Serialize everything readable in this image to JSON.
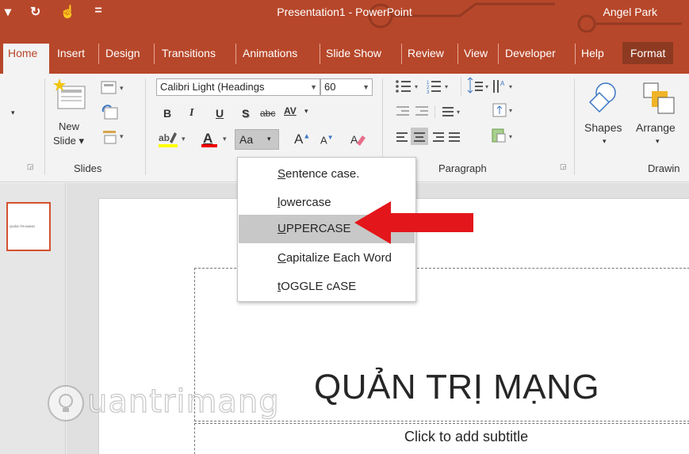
{
  "title_bar": {
    "qat_undo": "▾",
    "qat_redo": "↻",
    "qat_touch": "☝",
    "qat_customize": "=",
    "app_title": "Presentation1  -  PowerPoint",
    "user_name": "Angel Park"
  },
  "tabs": [
    {
      "label": "Home",
      "active": true
    },
    {
      "label": "Insert"
    },
    {
      "label": "Design"
    },
    {
      "label": "Transitions"
    },
    {
      "label": "Animations"
    },
    {
      "label": "Slide Show"
    },
    {
      "label": "Review"
    },
    {
      "label": "View"
    },
    {
      "label": "Developer"
    },
    {
      "label": "Help"
    },
    {
      "label": "Format"
    }
  ],
  "ribbon": {
    "slides_group": {
      "new_slide_line1": "New",
      "new_slide_line2": "Slide ▾",
      "label": "Slides"
    },
    "font_group": {
      "font_name": "Calibri Light (Headings",
      "font_size": "60",
      "bold": "B",
      "italic": "I",
      "underline": "U",
      "shadow": "S",
      "strike": "abc",
      "spacing": "AV",
      "change_case": "Aa",
      "grow": "A",
      "shrink": "A"
    },
    "paragraph_group": {
      "label": "Paragraph"
    },
    "drawing_group": {
      "shapes": "Shapes",
      "arrange": "Arrange",
      "label": "Drawin"
    }
  },
  "change_case_menu": {
    "items": [
      {
        "label": "Sentence case.",
        "underline": "S",
        "rest": "entence case."
      },
      {
        "label": "lowercase",
        "underline": "l",
        "rest": "owercase"
      },
      {
        "label": "UPPERCASE",
        "underline": "U",
        "rest": "PPERCASE",
        "highlighted": true
      },
      {
        "label": "Capitalize Each Word",
        "underline": "C",
        "rest": "apitalize Each Word"
      },
      {
        "label": "tOGGLE cASE",
        "underline": "t",
        "rest": "OGGLE cASE"
      }
    ]
  },
  "slide": {
    "title": "QUẢN TRỊ MẠNG",
    "subtitle_placeholder": "Click to add subtitle"
  },
  "watermark": {
    "text": "uantrimang"
  },
  "colors": {
    "accent": "#b7472a",
    "arrow": "#e3161b",
    "highlight": "#c8c8c8"
  }
}
